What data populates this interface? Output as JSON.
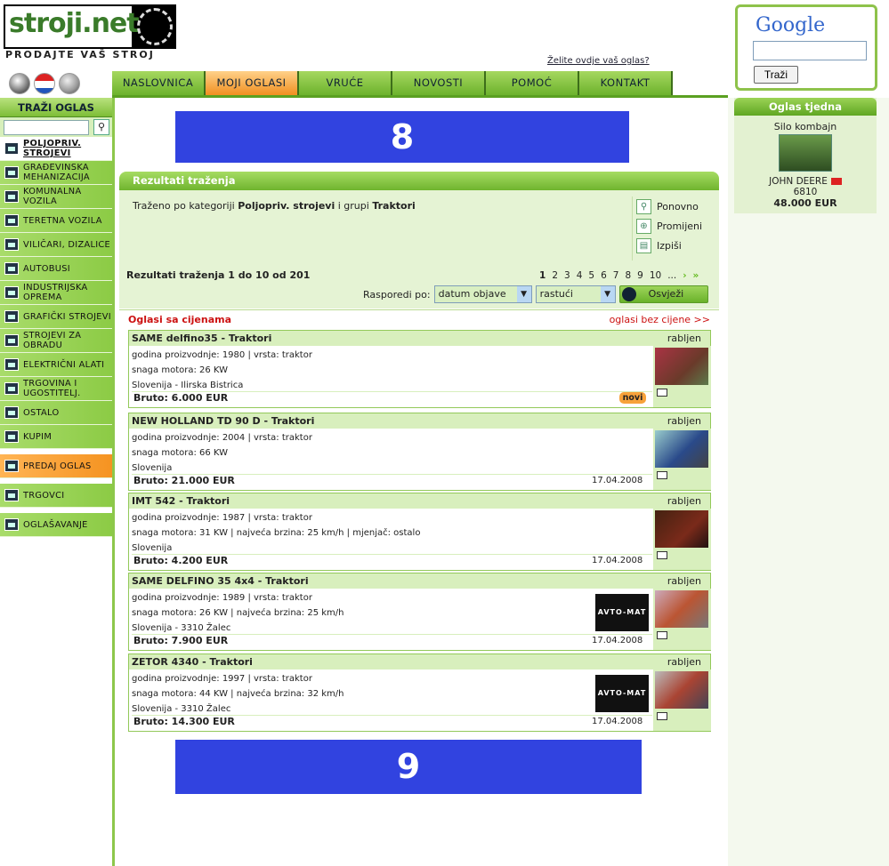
{
  "site": {
    "logo_text": "stroji.net",
    "tagline": "PRODAJTE VAŠ STROJ",
    "ad_link": "Želite ovdje vaš oglas?"
  },
  "nav": [
    "NASLOVNICA",
    "MOJI OGLASI",
    "VRUĆE",
    "NOVOSTI",
    "POMOĆ",
    "KONTAKT"
  ],
  "google": {
    "logo": "Google",
    "button": "Traži"
  },
  "sidebar": {
    "title": "TRAŽI OGLAS",
    "categories": [
      "POLJOPRIV. STROJEVI",
      "GRAĐEVINSKA MEHANIZACIJA",
      "KOMUNALNA VOZILA",
      "TERETNA VOZILA",
      "VILIČARI, DIZALICE",
      "AUTOBUSI",
      "INDUSTRIJSKA OPREMA",
      "GRAFIČKI STROJEVI",
      "STROJEVI ZA OBRADU",
      "ELEKTRIČNI ALATI",
      "TRGOVINA I UGOSTITELJ.",
      "OSTALO",
      "KUPIM"
    ],
    "extras": [
      "PREDAJ OGLAS",
      "TRGOVCI",
      "OGLAŠAVANJE"
    ]
  },
  "week": {
    "title": "Oglas tjedna",
    "name": "Silo kombajn",
    "brand": "JOHN DEERE",
    "model": "6810",
    "price": "48.000 EUR"
  },
  "banners": {
    "top": "8",
    "bottom": "9"
  },
  "results": {
    "title": "Rezultati traženja",
    "crit_pre": "Traženo po kategoriji ",
    "crit_cat": "Poljopriv. strojevi",
    "crit_mid": " i grupi ",
    "crit_group": "Traktori",
    "actions": [
      "Ponovno",
      "Promijeni",
      "Izpiši"
    ],
    "count": "Rezultati traženja 1 do 10 od 201",
    "pages": [
      "1",
      "2",
      "3",
      "4",
      "5",
      "6",
      "7",
      "8",
      "9",
      "10",
      "..."
    ],
    "sort_label": "Rasporedi po:",
    "sort_field": "datum objave",
    "sort_order": "rastući",
    "refresh": "Osvježi"
  },
  "section": {
    "left": "Oglasi sa cijenama",
    "right": "oglasi bez cijene >>"
  },
  "listings": [
    {
      "title": "SAME delfino35 - Traktori",
      "seller": "rabljen",
      "l1": "godina proizvodnje: 1980 | vrsta: traktor",
      "l2": "snaga motora: 26 KW",
      "l3": "Slovenija - Ilirska Bistrica",
      "price": "Bruto: 6.000 EUR",
      "date": "",
      "badge": "novi",
      "logo": ""
    },
    {
      "title": "NEW HOLLAND TD 90 D - Traktori",
      "seller": "rabljen",
      "l1": "godina proizvodnje: 2004 | vrsta: traktor",
      "l2": "snaga motora: 66 KW",
      "l3": "Slovenija",
      "price": "Bruto: 21.000 EUR",
      "date": "17.04.2008",
      "badge": "",
      "logo": ""
    },
    {
      "title": "IMT 542 - Traktori",
      "seller": "rabljen",
      "l1": "godina proizvodnje: 1987 | vrsta: traktor",
      "l2": "snaga motora: 31 KW | najveća brzina: 25 km/h | mjenjač: ostalo",
      "l3": "Slovenija",
      "price": "Bruto: 4.200 EUR",
      "date": "17.04.2008",
      "badge": "",
      "logo": ""
    },
    {
      "title": "SAME DELFINO 35 4x4 - Traktori",
      "seller": "rabljen",
      "l1": "godina proizvodnje: 1989 | vrsta: traktor",
      "l2": "snaga motora: 26 KW | najveća brzina: 25 km/h",
      "l3": "Slovenija - 3310 Žalec",
      "price": "Bruto: 7.900 EUR",
      "date": "17.04.2008",
      "badge": "",
      "logo": "AVTO-MAT"
    },
    {
      "title": "ZETOR 4340 - Traktori",
      "seller": "rabljen",
      "l1": "godina proizvodnje: 1997 | vrsta: traktor",
      "l2": "snaga motora: 44 KW | najveća brzina: 32 km/h",
      "l3": "Slovenija - 3310 Žalec",
      "price": "Bruto: 14.300 EUR",
      "date": "17.04.2008",
      "badge": "",
      "logo": "AVTO-MAT"
    }
  ]
}
